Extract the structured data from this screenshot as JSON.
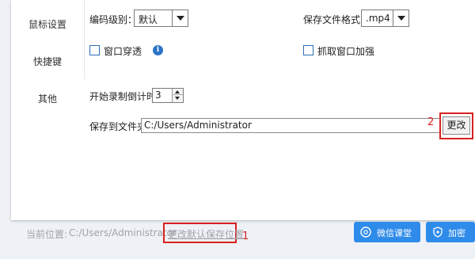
{
  "sidebar": {
    "items": [
      {
        "label": "鼠标设置"
      },
      {
        "label": "快捷键"
      },
      {
        "label": "其他"
      }
    ]
  },
  "settings": {
    "encoding_label": "编码级别：",
    "encoding_value": "默认",
    "format_label": "保存文件格式：",
    "format_value": ".mp4",
    "window_pass_label": "窗口穿透",
    "capture_label": "抓取窗口加强",
    "countdown_label": "开始录制倒计时:",
    "countdown_value": "3",
    "folder_label": "保存到文件夹:",
    "folder_value": "C:/Users/Administrator",
    "change_label": "更改"
  },
  "annotations": {
    "one": "1",
    "two": "2"
  },
  "footer": {
    "current_label": "当前位置:",
    "current_path": "C:/Users/Administrator",
    "default_link": "更改默认保存位置",
    "wechat_label": "微信课堂",
    "encrypt_label": "加密"
  },
  "colors": {
    "accent": "#2f8bea",
    "highlight": "#d92020"
  },
  "icons": {
    "info": "info-icon",
    "wechat": "wechat-icon",
    "shield": "shield-icon"
  }
}
